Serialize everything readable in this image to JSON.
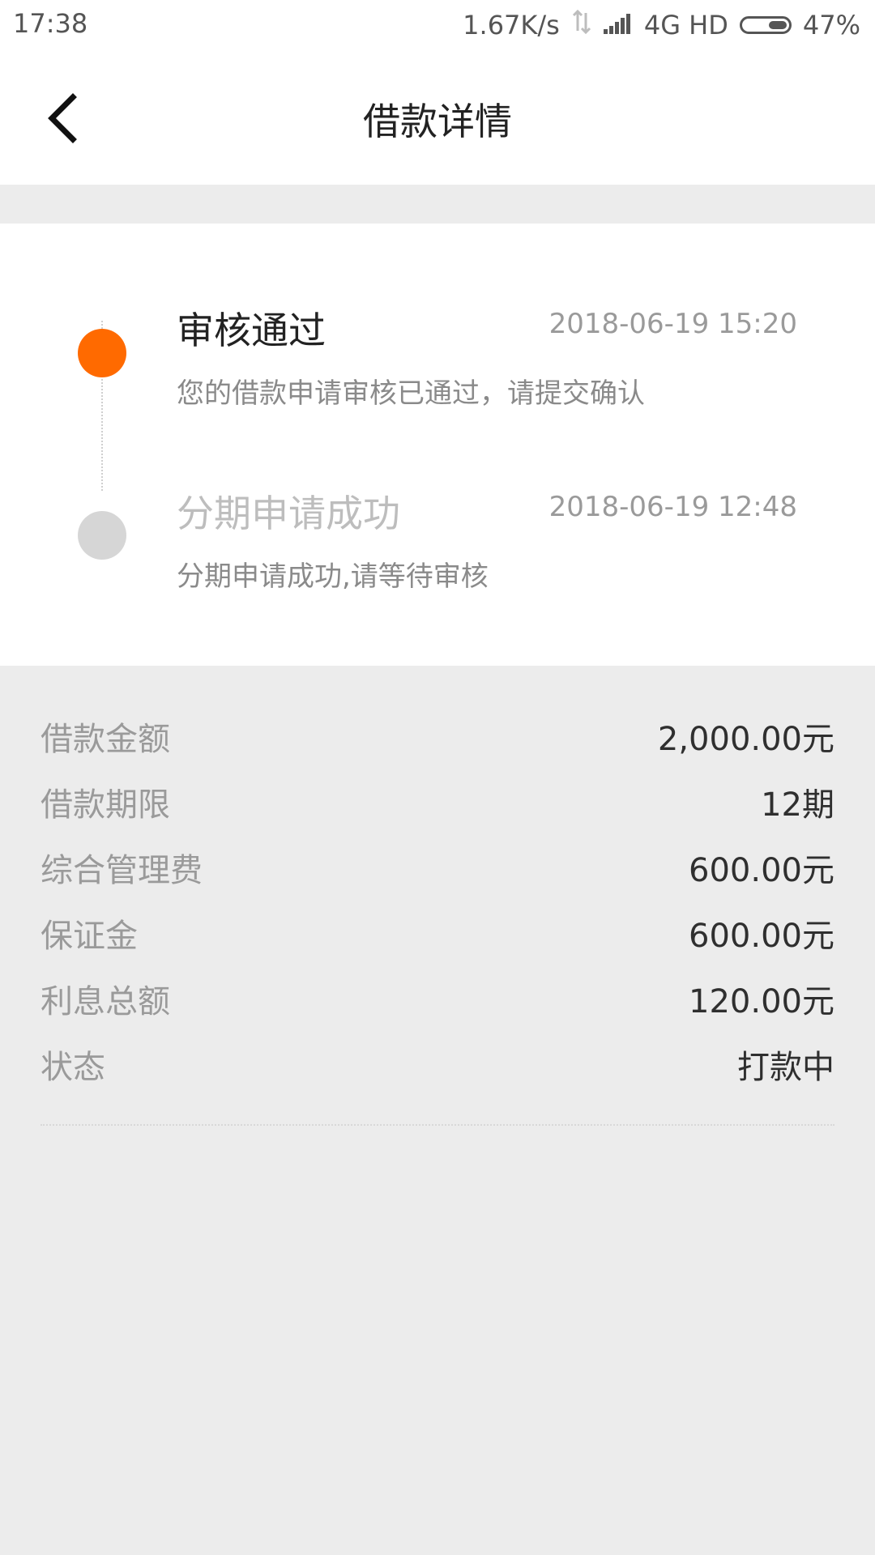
{
  "status_bar": {
    "time": "17:38",
    "network_speed": "1.67K/s",
    "network_type": "4G HD",
    "battery": "47%"
  },
  "header": {
    "title": "借款详情"
  },
  "timeline": [
    {
      "title": "审核通过",
      "time": "2018-06-19 15:20",
      "desc": "您的借款申请审核已通过，请提交确认",
      "status": "active"
    },
    {
      "title": "分期申请成功",
      "time": "2018-06-19 12:48",
      "desc": "分期申请成功,请等待审核",
      "status": "inactive"
    }
  ],
  "details": [
    {
      "label": "借款金额",
      "value": "2,000.00元"
    },
    {
      "label": "借款期限",
      "value": "12期"
    },
    {
      "label": "综合管理费",
      "value": "600.00元"
    },
    {
      "label": "保证金",
      "value": "600.00元"
    },
    {
      "label": "利息总额",
      "value": "120.00元"
    },
    {
      "label": "状态",
      "value": "打款中"
    }
  ],
  "colors": {
    "accent": "#ff6a00",
    "inactive_dot": "#d6d6d6",
    "page_bg": "#ececec"
  },
  "icons": {
    "back": "chevron-left-icon",
    "data_transfer": "data-transfer-icon",
    "signal": "signal-bars-icon",
    "battery": "battery-icon"
  }
}
